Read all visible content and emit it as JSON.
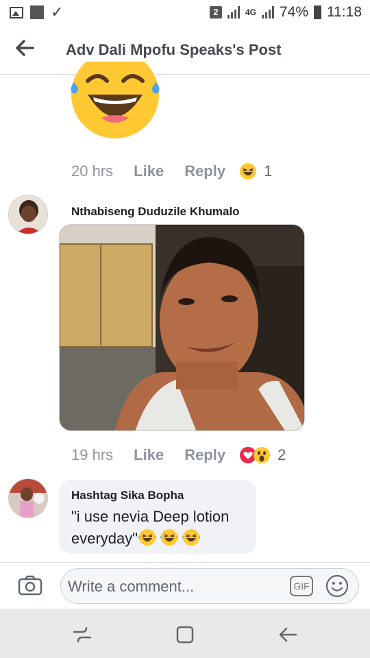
{
  "status_bar": {
    "sim_badge": "2",
    "network": "4G",
    "battery": "74%",
    "time": "11:18"
  },
  "header": {
    "title": "Adv Dali Mpofu Speaks's Post",
    "back_icon": "back-arrow-icon"
  },
  "comment1_meta": {
    "time": "20 hrs",
    "like": "Like",
    "reply": "Reply",
    "reaction_count": "1",
    "reaction": "laughing-emoji"
  },
  "comment2": {
    "author": "Nthabiseng Duduzile Khumalo",
    "time": "19 hrs",
    "like": "Like",
    "reply": "Reply",
    "reaction_count": "2",
    "reactions": [
      "love-reaction",
      "wow-reaction"
    ]
  },
  "comment3": {
    "author": "Hashtag Sika Bopha",
    "text": "\"i use nevia Deep lotion everyday\"",
    "emojis": [
      "laughing-emoji",
      "laughing-emoji",
      "laughing-emoji"
    ]
  },
  "composer": {
    "placeholder": "Write a comment...",
    "gif_label": "GIF"
  },
  "navbar": {
    "items": [
      "recent-apps-icon",
      "home-icon",
      "back-icon"
    ]
  },
  "colors": {
    "text_gray": "#8d949e",
    "emoji_yellow": "#ffd23f",
    "love_red": "#f0284a"
  }
}
